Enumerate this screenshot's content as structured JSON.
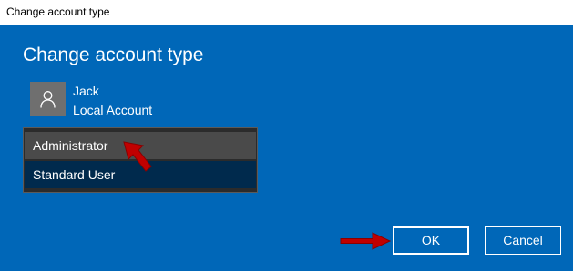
{
  "window": {
    "title": "Change account type"
  },
  "dialog": {
    "heading": "Change account type",
    "user": {
      "name": "Jack",
      "account_type": "Local Account",
      "avatar_icon": "user-silhouette-icon"
    },
    "account_types": [
      {
        "label": "Administrator",
        "state": "highlighted"
      },
      {
        "label": "Standard User",
        "state": "selected"
      }
    ],
    "buttons": {
      "ok_label": "OK",
      "cancel_label": "Cancel"
    }
  },
  "annotations": {
    "arrow_color": "#c00000"
  },
  "colors": {
    "dialog_background": "#0067b8",
    "list_background": "#2b2b2b",
    "hover_item": "#4a4a4a",
    "selected_item": "#002a4d",
    "avatar_background": "#6f6f6f"
  }
}
